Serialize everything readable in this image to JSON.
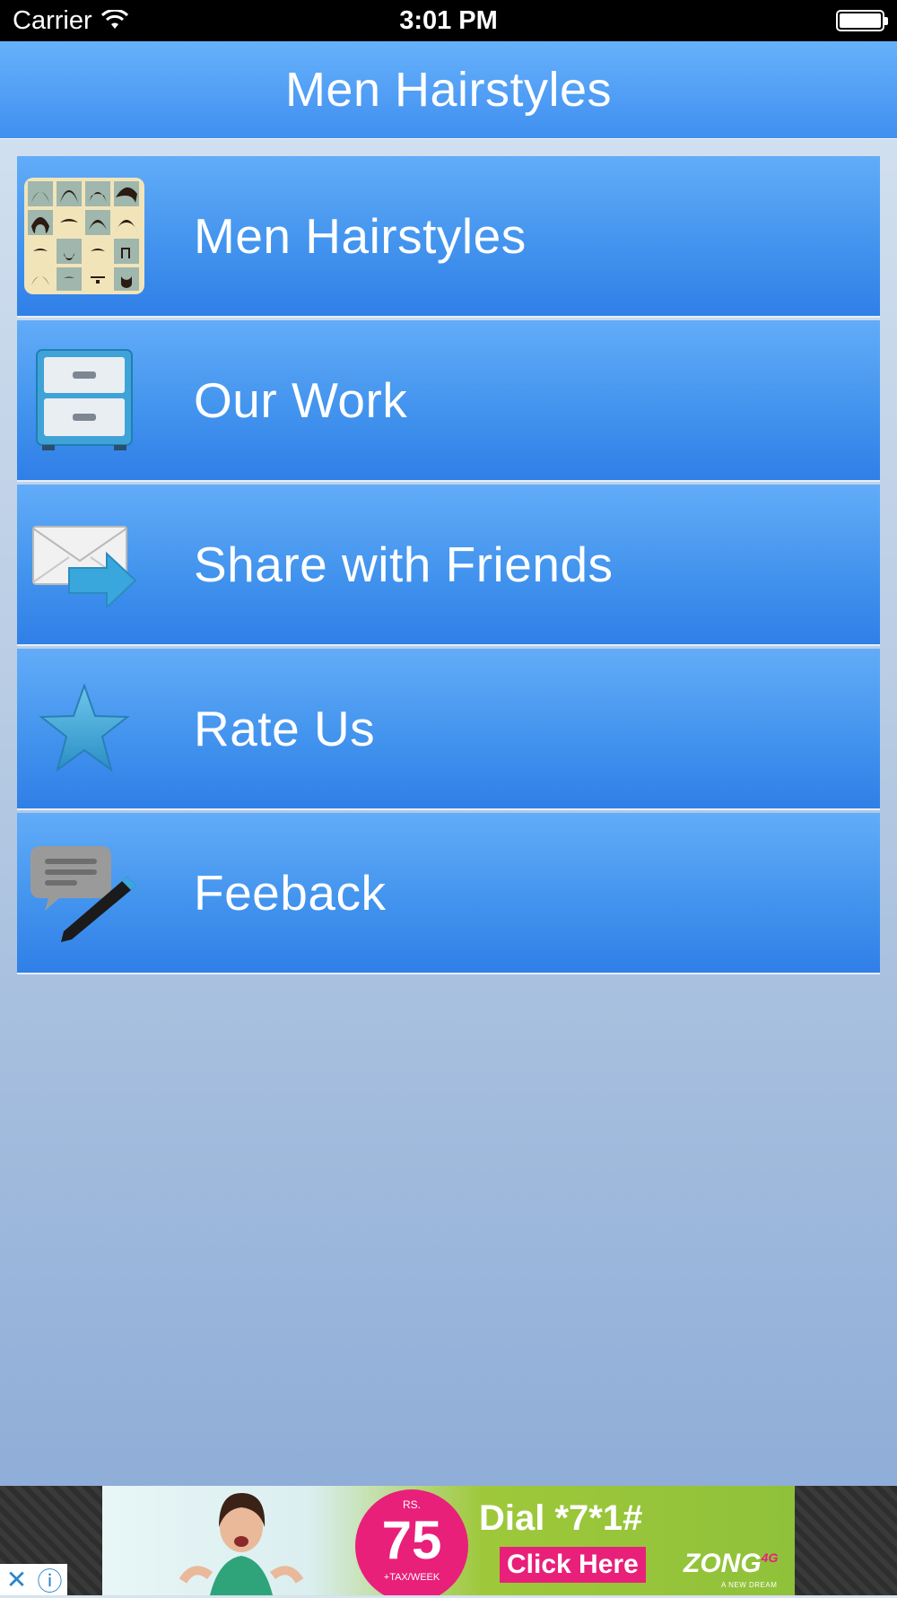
{
  "status_bar": {
    "carrier": "Carrier",
    "time": "3:01 PM"
  },
  "nav": {
    "title": "Men Hairstyles"
  },
  "menu": [
    {
      "label": "Men Hairstyles",
      "icon": "hairstyles-grid-icon"
    },
    {
      "label": "Our Work",
      "icon": "file-cabinet-icon"
    },
    {
      "label": "Share with Friends",
      "icon": "mail-share-icon"
    },
    {
      "label": "Rate Us",
      "icon": "star-icon"
    },
    {
      "label": "Feeback",
      "icon": "chat-pencil-icon"
    }
  ],
  "ad": {
    "currency": "RS.",
    "price": "75",
    "tax": "+TAX/WEEK",
    "dial": "Dial *7*1#",
    "cta": "Click Here",
    "brand": "ZONG",
    "brand_suffix": "4G",
    "tagline": "A NEW DREAM"
  },
  "colors": {
    "nav_top": "#67b1fb",
    "nav_bottom": "#3f8ff0",
    "item_top": "#62acf8",
    "item_bottom": "#2f7fe8",
    "ad_pink": "#e8207a"
  }
}
